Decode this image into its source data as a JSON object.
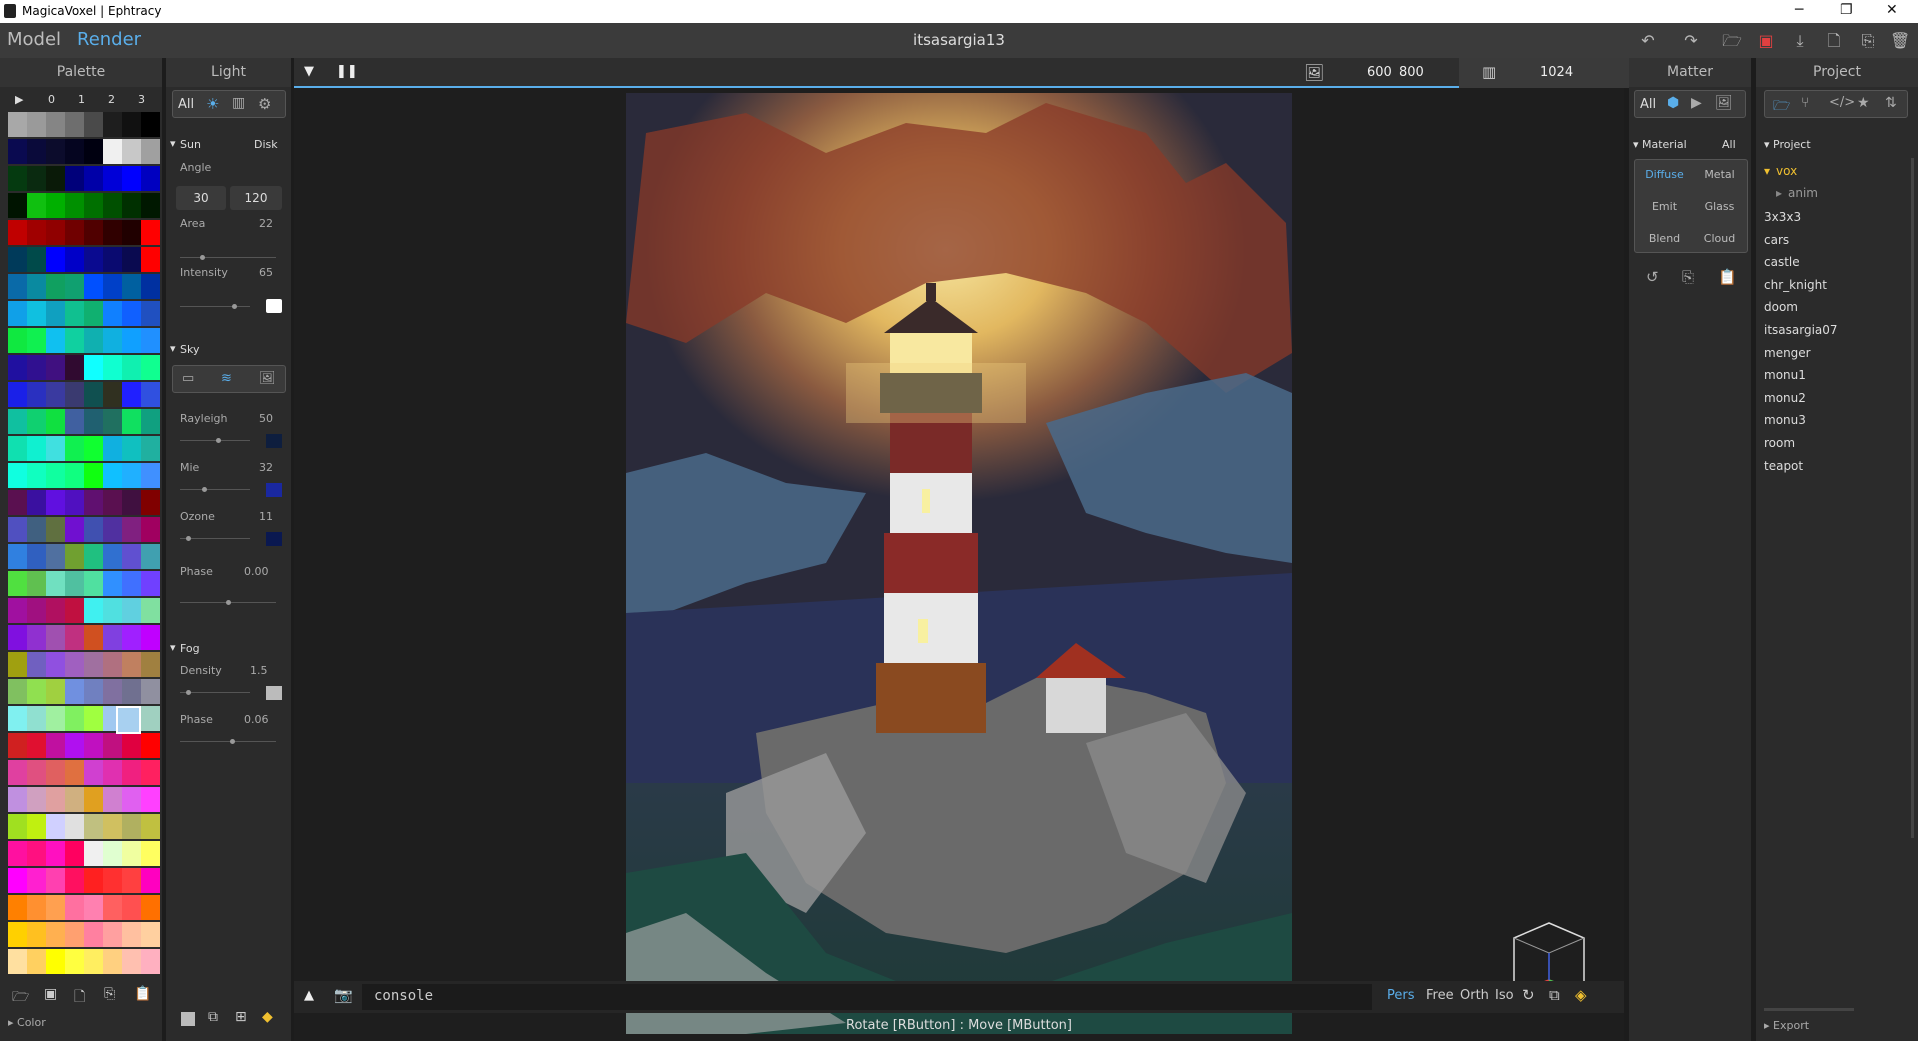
{
  "window": {
    "title": "MagicaVoxel | Ephtracy",
    "minimize": "─",
    "maximize": "❐",
    "close": "✕"
  },
  "topbar": {
    "model_tab": "Model",
    "render_tab": "Render",
    "filename": "itsasargia13"
  },
  "palette": {
    "title": "Palette",
    "page_play": "▶",
    "pages": [
      "0",
      "1",
      "2",
      "3"
    ],
    "footer_label": "▸ Color",
    "colors": [
      [
        "#a8a8a8",
        "#9a9a9a",
        "#858585",
        "#6e6e6e",
        "#4a4a4a",
        "#1e1e1e",
        "#111111",
        "#000000"
      ],
      [
        "#0a0a50",
        "#0a0a3a",
        "#0c0c2c",
        "#050520",
        "#000010",
        "#f0f0f0",
        "#c8c8c8",
        "#a0a0a0"
      ],
      [
        "#053a10",
        "#0a2a10",
        "#0a1a08",
        "#00007a",
        "#0000a8",
        "#0000d8",
        "#0000ff",
        "#0000c0"
      ],
      [
        "#001400",
        "#10c010",
        "#00b000",
        "#009000",
        "#007000",
        "#005000",
        "#003000",
        "#001800"
      ],
      [
        "#c00000",
        "#a00000",
        "#900000",
        "#700000",
        "#500000",
        "#300000",
        "#200000",
        "#ff0000"
      ],
      [
        "#003a5a",
        "#004a4a",
        "#0000ff",
        "#0000c8",
        "#0a0a90",
        "#0a0a70",
        "#0a0a50",
        "#ff0000"
      ],
      [
        "#0a6aa8",
        "#0a8aa0",
        "#10a060",
        "#10a070",
        "#0050ff",
        "#0040c8",
        "#0060a0",
        "#0030a0"
      ],
      [
        "#10a0e8",
        "#10c0e0",
        "#10a0c0",
        "#10c090",
        "#10b070",
        "#1080ff",
        "#1060ff",
        "#2050c0"
      ],
      [
        "#10e840",
        "#10f050",
        "#10c0f0",
        "#10d0a0",
        "#10b0b0",
        "#10b0e0",
        "#10a0ff",
        "#2090ff"
      ],
      [
        "#2010a0",
        "#301090",
        "#401080",
        "#300a30",
        "#10ffff",
        "#10ffd0",
        "#10f0b0",
        "#10ff90"
      ],
      [
        "#1a20e8",
        "#2a30c0",
        "#3a3aa0",
        "#3a3a70",
        "#105050",
        "#303020",
        "#2020ff",
        "#3050e0"
      ],
      [
        "#10c0a0",
        "#10d070",
        "#10e040",
        "#4060a0",
        "#206070",
        "#207060",
        "#10e060",
        "#10a080"
      ],
      [
        "#10e0b0",
        "#10f0d0",
        "#40e0e0",
        "#10f050",
        "#10ff30",
        "#10b0e0",
        "#10c0c0",
        "#20b0a0"
      ],
      [
        "#10ffe0",
        "#10ffc0",
        "#10ffa0",
        "#10ff80",
        "#10ff10",
        "#10c0ff",
        "#20b0ff",
        "#4090ff"
      ],
      [
        "#5a1050",
        "#3a10a0",
        "#6010e0",
        "#5010c0",
        "#601070",
        "#5a1050",
        "#401040",
        "#800000"
      ],
      [
        "#5050c0",
        "#406080",
        "#607040",
        "#7010d0",
        "#4050b0",
        "#5030a0",
        "#802080",
        "#a00060"
      ],
      [
        "#3080e0",
        "#3060c0",
        "#5070a0",
        "#70a030",
        "#20c080",
        "#3070d0",
        "#6050d0",
        "#40a0b0"
      ],
      [
        "#50e040",
        "#60c050",
        "#70e0c0",
        "#50c0a0",
        "#50e0a0",
        "#3090ff",
        "#4070ff",
        "#7040ff"
      ],
      [
        "#a010a0",
        "#a01080",
        "#b01060",
        "#c01040",
        "#40f0f0",
        "#50e0e0",
        "#60d0e0",
        "#80e0a0"
      ],
      [
        "#8010e0",
        "#9030d0",
        "#a050b0",
        "#c03080",
        "#d05020",
        "#8040e0",
        "#a020ff",
        "#c000ff"
      ],
      [
        "#a0a010",
        "#7060c0",
        "#9050e0",
        "#a060c0",
        "#a070a0",
        "#b07080",
        "#c08060",
        "#a08040"
      ],
      [
        "#80c060",
        "#90e050",
        "#a0d040",
        "#7090e0",
        "#7080c0",
        "#8070a0",
        "#707090",
        "#9090a0"
      ],
      [
        "#80f0f0",
        "#90e0d0",
        "#a0f0a0",
        "#80f060",
        "#a0ff40",
        "#a0c8f0",
        "#b0b0d0",
        "#a0d0c0"
      ],
      [
        "#d02020",
        "#e01030",
        "#c010a0",
        "#b010f0",
        "#c010c0",
        "#c01080",
        "#e00040",
        "#ff0000"
      ],
      [
        "#e040a0",
        "#e05080",
        "#e06060",
        "#e07040",
        "#d040d0",
        "#e030b0",
        "#f02080",
        "#ff2060"
      ],
      [
        "#c090e0",
        "#d0a0c0",
        "#e0a0a0",
        "#d0b080",
        "#e0a020",
        "#d080d0",
        "#e060f0",
        "#ff40ff"
      ],
      [
        "#a0e020",
        "#c0f010",
        "#d0d0ff",
        "#e0e0e0",
        "#c0c080",
        "#d0c060",
        "#b0b060",
        "#c0c040"
      ],
      [
        "#ff10a0",
        "#ff1080",
        "#ff10c0",
        "#ff0060",
        "#f0f0f0",
        "#e0ffd0",
        "#f0ffa0",
        "#ffff60"
      ],
      [
        "#ff00ff",
        "#ff20d0",
        "#ff40b0",
        "#ff1060",
        "#ff2020",
        "#ff3030",
        "#ff4040",
        "#ff00c0"
      ],
      [
        "#ff8000",
        "#ff9030",
        "#ffa050",
        "#ff70a0",
        "#ff80b0",
        "#ff6060",
        "#ff5050",
        "#ff7000"
      ],
      [
        "#ffd000",
        "#ffc020",
        "#ffb050",
        "#ffa070",
        "#ff80a0",
        "#ffa0a0",
        "#ffc0a0",
        "#ffd0a0"
      ],
      [
        "#ffe0a0",
        "#ffd060",
        "#ffff00",
        "#ffff40",
        "#ffee60",
        "#ffd080",
        "#ffc0b0",
        "#ffb0c0"
      ]
    ]
  },
  "light": {
    "title": "Light",
    "filter_all": "All",
    "sun": {
      "label": "Sun",
      "mode": "Disk",
      "angle_label": "Angle",
      "angle1": "30",
      "angle2": "120",
      "area_label": "Area",
      "area": "22",
      "intensity_label": "Intensity",
      "intensity": "65"
    },
    "sky": {
      "label": "Sky",
      "rayleigh_label": "Rayleigh",
      "rayleigh": "50",
      "mie_label": "Mie",
      "mie": "32",
      "ozone_label": "Ozone",
      "ozone": "11",
      "phase_label": "Phase",
      "phase": "0.00"
    },
    "fog": {
      "label": "Fog",
      "density_label": "Density",
      "density": "1.5",
      "phase_label": "Phase",
      "phase": "0.06"
    }
  },
  "viewport": {
    "width_value": "600",
    "height_value": "800",
    "samples": "1024",
    "console_text": "console",
    "cam_modes": [
      "Pers",
      "Free",
      "Orth",
      "Iso"
    ],
    "status": "Rotate [RButton] : Move [MButton]"
  },
  "matter": {
    "title": "Matter",
    "filter_all": "All",
    "material_label": "Material",
    "material_all": "All",
    "materials": [
      "Diffuse",
      "Metal",
      "Emit",
      "Glass",
      "Blend",
      "Cloud"
    ]
  },
  "project": {
    "title": "Project",
    "section": "Project",
    "folder": "vox",
    "subfolder": "anim",
    "items": [
      "3x3x3",
      "cars",
      "castle",
      "chr_knight",
      "doom",
      "itsasargia07",
      "menger",
      "monu1",
      "monu2",
      "monu3",
      "room",
      "teapot"
    ],
    "export_label": "▸ Export"
  },
  "colors": {
    "accent": "#5aaeea",
    "highlight_folder": "#f0c030",
    "save_icon": "#e04040"
  }
}
